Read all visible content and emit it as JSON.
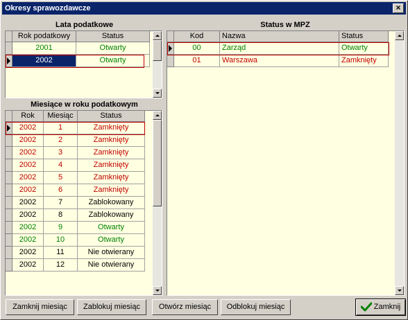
{
  "window": {
    "title": "Okresy sprawozdawcze",
    "close_glyph": "×"
  },
  "years": {
    "title": "Lata podatkowe",
    "headers": [
      "Rok podatkowy",
      "Status"
    ],
    "rows": [
      {
        "year": "2001",
        "status": "Otwarty",
        "color": "green",
        "selected": false
      },
      {
        "year": "2002",
        "status": "Otwarty",
        "color": "green",
        "selected": true
      }
    ]
  },
  "months": {
    "title": "Miesiące w roku podatkowym",
    "headers": [
      "Rok",
      "Miesiąc",
      "Status"
    ],
    "rows": [
      {
        "year": "2002",
        "month": "1",
        "status": "Zamknięty",
        "color": "red",
        "current": true
      },
      {
        "year": "2002",
        "month": "2",
        "status": "Zamknięty",
        "color": "red"
      },
      {
        "year": "2002",
        "month": "3",
        "status": "Zamknięty",
        "color": "red"
      },
      {
        "year": "2002",
        "month": "4",
        "status": "Zamknięty",
        "color": "red"
      },
      {
        "year": "2002",
        "month": "5",
        "status": "Zamknięty",
        "color": "red"
      },
      {
        "year": "2002",
        "month": "6",
        "status": "Zamknięty",
        "color": "red"
      },
      {
        "year": "2002",
        "month": "7",
        "status": "Zablokowany",
        "color": "black"
      },
      {
        "year": "2002",
        "month": "8",
        "status": "Zablokowany",
        "color": "black"
      },
      {
        "year": "2002",
        "month": "9",
        "status": "Otwarty",
        "color": "green"
      },
      {
        "year": "2002",
        "month": "10",
        "status": "Otwarty",
        "color": "green"
      },
      {
        "year": "2002",
        "month": "11",
        "status": "Nie otwierany",
        "color": "black"
      },
      {
        "year": "2002",
        "month": "12",
        "status": "Nie otwierany",
        "color": "black"
      }
    ]
  },
  "mpz": {
    "title": "Status w MPZ",
    "headers": [
      "Kod",
      "Nazwa",
      "Status"
    ],
    "rows": [
      {
        "code": "00",
        "name": "Zarząd",
        "status": "Otwarty",
        "color": "green",
        "current": true
      },
      {
        "code": "01",
        "name": "Warszawa",
        "status": "Zamknięty",
        "color": "red"
      }
    ]
  },
  "buttons": {
    "close_month": "Zamknij miesiąc",
    "lock_month": "Zablokuj miesiąc",
    "open_month": "Otwórz miesiąc",
    "unlock_month": "Odblokuj miesiąc",
    "close": "Zamknij"
  },
  "colors": {
    "red": "#c00000",
    "green": "#008000",
    "grid_bg": "#ffffe1",
    "selection": "#0a246a",
    "title_bar": "#0a246a"
  }
}
